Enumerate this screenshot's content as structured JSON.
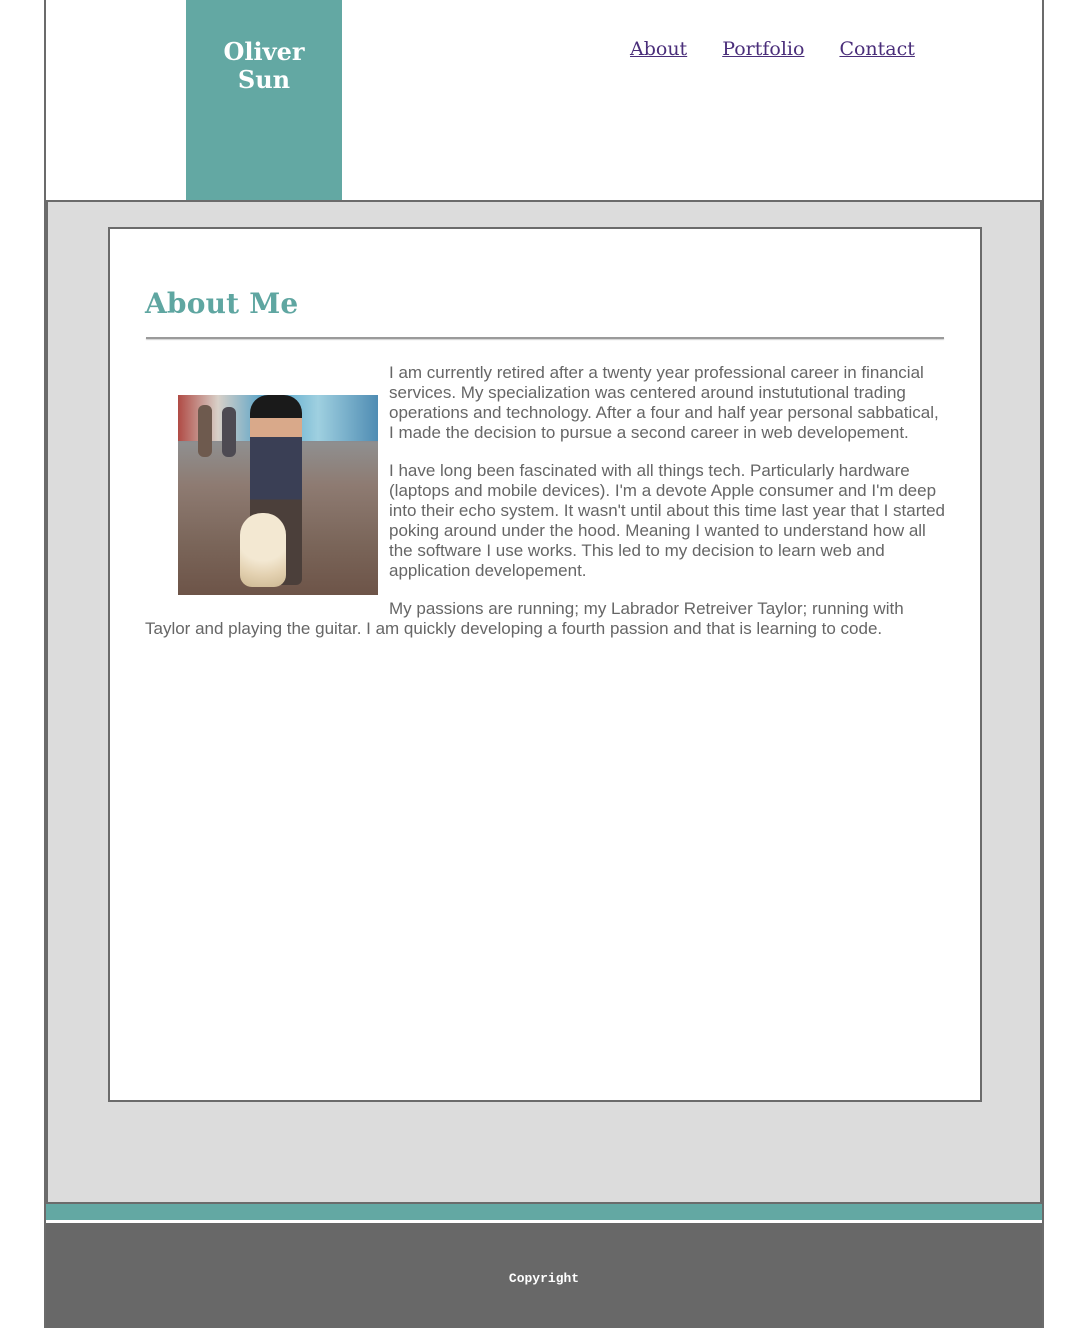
{
  "header": {
    "logo_line1": "Oliver",
    "logo_line2": "Sun",
    "nav": [
      {
        "label": "About"
      },
      {
        "label": "Portfolio"
      },
      {
        "label": "Contact"
      }
    ]
  },
  "main": {
    "heading": "About Me",
    "paragraphs": [
      "I am currently retired after a twenty year professional career in financial services. My specialization was centered around instututional trading operations and technology. After a four and half year personal sabbatical, I made the decision to pursue a second career in web developement.",
      "I have long been fascinated with all things tech. Particularly hardware (laptops and mobile devices). I'm a devote Apple consumer and I'm deep into their echo system. It wasn't until about this time last year that I started poking around under the hood. Meaning I wanted to understand how all the software I use works. This led to my decision to learn web and application developement.",
      "My passions are running; my Labrador Retreiver Taylor; running with Taylor and playing the guitar. I am quickly developing a fourth passion and that is learning to code."
    ]
  },
  "footer": {
    "copyright": "Copyright"
  },
  "colors": {
    "accent": "#63a8a3",
    "nav_link": "#4a2e7a",
    "main_bg": "#dcdcdc",
    "footer_bg": "#686868"
  }
}
